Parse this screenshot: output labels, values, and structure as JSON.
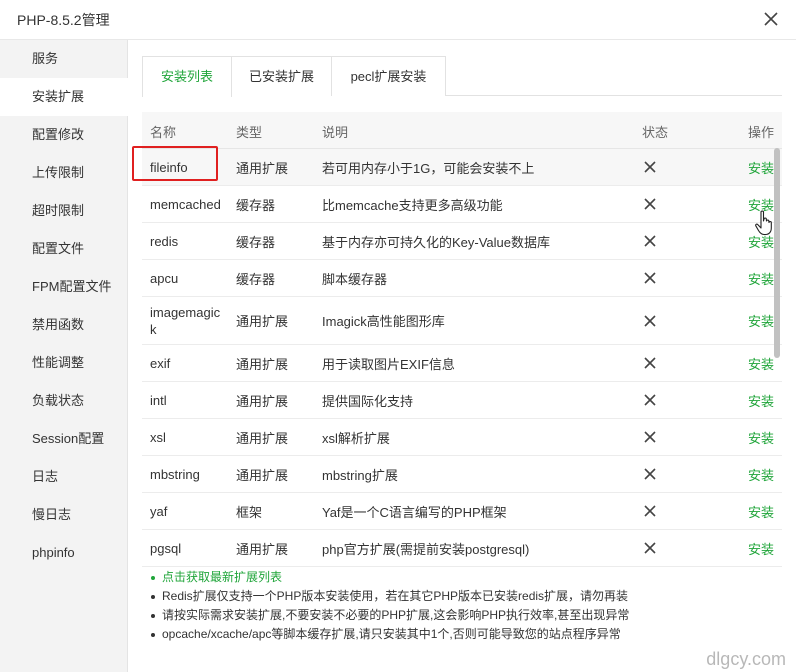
{
  "window": {
    "title": "PHP-8.5.2管理"
  },
  "sidebar": {
    "items": [
      {
        "label": "服务"
      },
      {
        "label": "安装扩展"
      },
      {
        "label": "配置修改"
      },
      {
        "label": "上传限制"
      },
      {
        "label": "超时限制"
      },
      {
        "label": "配置文件"
      },
      {
        "label": "FPM配置文件"
      },
      {
        "label": "禁用函数"
      },
      {
        "label": "性能调整"
      },
      {
        "label": "负载状态"
      },
      {
        "label": "Session配置"
      },
      {
        "label": "日志"
      },
      {
        "label": "慢日志"
      },
      {
        "label": "phpinfo"
      }
    ],
    "active": "安装扩展"
  },
  "tabs": [
    {
      "label": "安装列表"
    },
    {
      "label": "已安装扩展"
    },
    {
      "label": "pecl扩展安装"
    }
  ],
  "table": {
    "headers": {
      "name": "名称",
      "type": "类型",
      "desc": "说明",
      "status": "状态",
      "op": "操作"
    },
    "rows": [
      {
        "name": "fileinfo",
        "type": "通用扩展",
        "desc": "若可用内存小于1G，可能会安装不上",
        "status": "not-installed",
        "op": "安装"
      },
      {
        "name": "memcached",
        "type": "缓存器",
        "desc": "比memcache支持更多高级功能",
        "status": "not-installed",
        "op": "安装"
      },
      {
        "name": "redis",
        "type": "缓存器",
        "desc": "基于内存亦可持久化的Key-Value数据库",
        "status": "not-installed",
        "op": "安装"
      },
      {
        "name": "apcu",
        "type": "缓存器",
        "desc": "脚本缓存器",
        "status": "not-installed",
        "op": "安装"
      },
      {
        "name": "imagemagick",
        "type": "通用扩展",
        "desc": "Imagick高性能图形库",
        "status": "not-installed",
        "op": "安装"
      },
      {
        "name": "exif",
        "type": "通用扩展",
        "desc": "用于读取图片EXIF信息",
        "status": "not-installed",
        "op": "安装"
      },
      {
        "name": "intl",
        "type": "通用扩展",
        "desc": "提供国际化支持",
        "status": "not-installed",
        "op": "安装"
      },
      {
        "name": "xsl",
        "type": "通用扩展",
        "desc": "xsl解析扩展",
        "status": "not-installed",
        "op": "安装"
      },
      {
        "name": "mbstring",
        "type": "通用扩展",
        "desc": "mbstring扩展",
        "status": "not-installed",
        "op": "安装"
      },
      {
        "name": "yaf",
        "type": "框架",
        "desc": "Yaf是一个C语言编写的PHP框架",
        "status": "not-installed",
        "op": "安装"
      },
      {
        "name": "pgsql",
        "type": "通用扩展",
        "desc": "php官方扩展(需提前安装postgresql)",
        "status": "not-installed",
        "op": "安装"
      }
    ]
  },
  "notes": [
    {
      "text": "点击获取最新扩展列表"
    },
    {
      "text": "Redis扩展仅支持一个PHP版本安装使用，若在其它PHP版本已安装redis扩展，请勿再装"
    },
    {
      "text": "请按实际需求安装扩展,不要安装不必要的PHP扩展,这会影响PHP执行效率,甚至出现异常"
    },
    {
      "text": "opcache/xcache/apc等脚本缓存扩展,请只安装其中1个,否则可能导致您的站点程序异常"
    }
  ],
  "watermark": "dlgcy.com",
  "colors": {
    "accent": "#20a53a",
    "highlight": "#e02020",
    "sidebar_bg": "#f3f3f3"
  },
  "icons": {
    "close": "close-icon",
    "status": "x-icon",
    "cursor": "hand-pointer-icon"
  }
}
